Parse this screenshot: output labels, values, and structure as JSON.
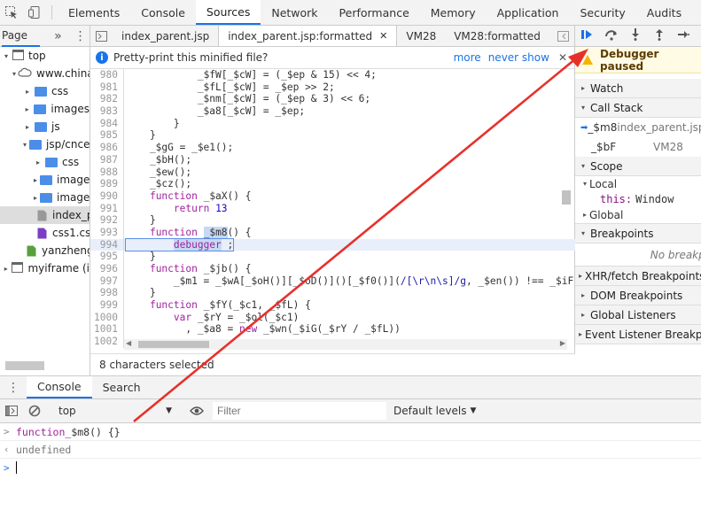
{
  "topbar": {
    "tabs": [
      "Elements",
      "Console",
      "Sources",
      "Network",
      "Performance",
      "Memory",
      "Application",
      "Security",
      "Audits"
    ],
    "active": "Sources"
  },
  "navigator": {
    "tab_label": "Page",
    "more": "»",
    "tree": [
      {
        "label": "top",
        "indent": 0,
        "type": "frame",
        "tri": "▾"
      },
      {
        "label": "www.chinau",
        "indent": 1,
        "type": "cloud",
        "tri": "▾"
      },
      {
        "label": "css",
        "indent": 2,
        "type": "folder",
        "tri": "▸"
      },
      {
        "label": "images",
        "indent": 2,
        "type": "folder",
        "tri": "▸"
      },
      {
        "label": "js",
        "indent": 2,
        "type": "folder",
        "tri": "▸"
      },
      {
        "label": "jsp/cnceb",
        "indent": 2,
        "type": "folder",
        "tri": "▾"
      },
      {
        "label": "css",
        "indent": 3,
        "type": "folder",
        "tri": "▸"
      },
      {
        "label": "images",
        "indent": 3,
        "type": "folder",
        "tri": "▸"
      },
      {
        "label": "images",
        "indent": 3,
        "type": "folder",
        "tri": "▸"
      },
      {
        "label": "index_p",
        "indent": 3,
        "type": "file-grey",
        "tri": "",
        "selected": true
      },
      {
        "label": "css1.cs",
        "indent": 3,
        "type": "file-purple",
        "tri": ""
      },
      {
        "label": "yanzheng",
        "indent": 2,
        "type": "file-green",
        "tri": ""
      },
      {
        "label": "myiframe (i",
        "indent": 0,
        "type": "frame",
        "tri": "▸"
      }
    ]
  },
  "editor": {
    "file_tabs": [
      "index_parent.jsp",
      "index_parent.jsp:formatted",
      "VM28",
      "VM28:formatted"
    ],
    "active_tab": "index_parent.jsp:formatted",
    "info_text": "Pretty-print this minified file?",
    "info_more": "more",
    "info_never": "never show",
    "code_lines": [
      {
        "n": "980",
        "h": "            <span>_$fW[_$cW] = (_$ep & 15) << 4;</span>"
      },
      {
        "n": "981",
        "h": "            _$fL[_$cW] = _$ep >> 2;"
      },
      {
        "n": "982",
        "h": "            _$nm[_$cW] = (_$ep & 3) << 6;"
      },
      {
        "n": "983",
        "h": "            _$a8[_$cW] = _$ep;"
      },
      {
        "n": "984",
        "h": "        }"
      },
      {
        "n": "985",
        "h": "    }"
      },
      {
        "n": "986",
        "h": "    _$gG = _$e1();"
      },
      {
        "n": "987",
        "h": "    _$bH();"
      },
      {
        "n": "988",
        "h": "    _$ew();"
      },
      {
        "n": "989",
        "h": "    _$cz();"
      },
      {
        "n": "990",
        "h": "    <span class=\"kw\">function</span> _$aX() {"
      },
      {
        "n": "991",
        "h": "        <span class=\"kw\">return</span> <span class=\"num\">13</span>"
      },
      {
        "n": "992",
        "h": "    }"
      },
      {
        "n": "993",
        "h": "    <span class=\"kw\">function</span> <span class=\"sel\">_$m8</span>() {"
      },
      {
        "n": "994",
        "h": "        <span class=\"kw sel\">debugger</span> ;",
        "hl": true
      },
      {
        "n": "995",
        "h": "    }"
      },
      {
        "n": "996",
        "h": "    <span class=\"kw\">function</span> _$jb() {"
      },
      {
        "n": "997",
        "h": "        _$m1 = _$wA[_$oH()][_$oD()]()[_$f0()](<span class=\"re\">/[\\r\\n\\s]/g</span>, _$en()) !== _$iF"
      },
      {
        "n": "998",
        "h": "    }"
      },
      {
        "n": "999",
        "h": "    <span class=\"kw\">function</span> _$fY(_$c1, _$fL) {"
      },
      {
        "n": "1000",
        "h": "        <span class=\"kw\">var</span> _$rY = _$ol(_$c1)"
      },
      {
        "n": "1001",
        "h": "          , _$a8 = <span class=\"kw\">new</span> _$wn(_$iG(_$rY / _$fL))"
      },
      {
        "n": "1002",
        "h": ""
      }
    ],
    "status": "8 characters selected"
  },
  "debugger": {
    "paused": "Debugger paused",
    "sections": {
      "watch": "Watch",
      "call_stack": "Call Stack",
      "scope": "Scope",
      "breakpoints": "Breakpoints",
      "xhr": "XHR/fetch Breakpoints",
      "dom": "DOM Breakpoints",
      "global_listeners": "Global Listeners",
      "event_listener": "Event Listener Breakpoints"
    },
    "call_stack": [
      {
        "fn": "_$m8",
        "loc": "index_parent.jsp"
      },
      {
        "fn": "_$bF",
        "loc": "VM28"
      }
    ],
    "scope": {
      "local": "Local",
      "this_key": "this:",
      "this_val": "Window",
      "global": "Global"
    },
    "no_breakpoints": "No breakpoints"
  },
  "drawer": {
    "tabs": [
      "Console",
      "Search"
    ],
    "active": "Console"
  },
  "console_toolbar": {
    "context": "top",
    "filter_placeholder": "Filter",
    "levels": "Default levels"
  },
  "console": {
    "input_echo_kw": "function",
    "input_echo_rest": " _$m8() {}",
    "result": "undefined"
  }
}
